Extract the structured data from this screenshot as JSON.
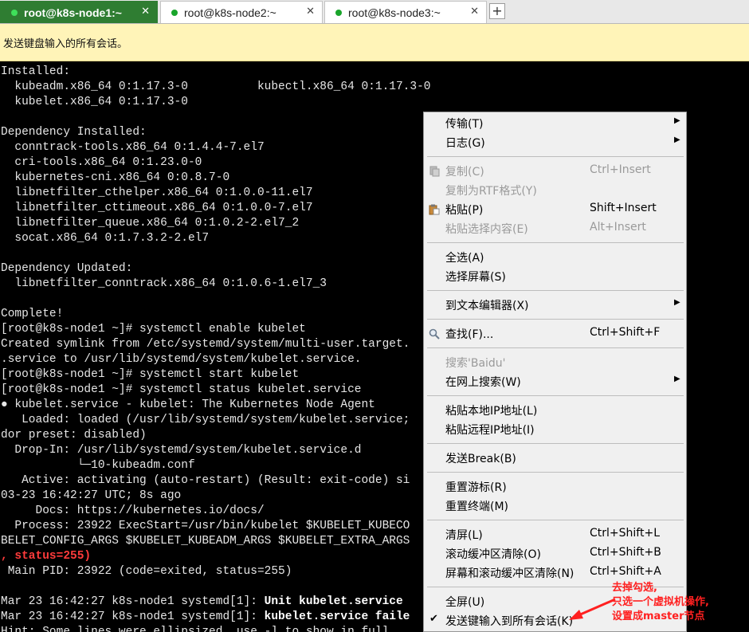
{
  "tabs": [
    {
      "label": "root@k8s-node1:~",
      "close": "✕"
    },
    {
      "label": "root@k8s-node2:~",
      "close": "✕"
    },
    {
      "label": "root@k8s-node3:~",
      "close": "✕"
    }
  ],
  "new_tab": "+",
  "banner": "发送键盘输入的所有会话。",
  "terminal": {
    "lines": [
      "Installed:",
      "  kubeadm.x86_64 0:1.17.3-0          kubectl.x86_64 0:1.17.3-0",
      "  kubelet.x86_64 0:1.17.3-0",
      "",
      "Dependency Installed:",
      "  conntrack-tools.x86_64 0:1.4.4-7.el7",
      "  cri-tools.x86_64 0:1.23.0-0",
      "  kubernetes-cni.x86_64 0:0.8.7-0",
      "  libnetfilter_cthelper.x86_64 0:1.0.0-11.el7",
      "  libnetfilter_cttimeout.x86_64 0:1.0.0-7.el7",
      "  libnetfilter_queue.x86_64 0:1.0.2-2.el7_2",
      "  socat.x86_64 0:1.7.3.2-2.el7",
      "",
      "Dependency Updated:",
      "  libnetfilter_conntrack.x86_64 0:1.0.6-1.el7_3",
      "",
      "Complete!",
      "[root@k8s-node1 ~]# systemctl enable kubelet",
      "Created symlink from /etc/systemd/system/multi-user.target.",
      ".service to /usr/lib/systemd/system/kubelet.service.",
      "[root@k8s-node1 ~]# systemctl start kubelet",
      "[root@k8s-node1 ~]# systemctl status kubelet.service",
      "● kubelet.service - kubelet: The Kubernetes Node Agent",
      "   Loaded: loaded (/usr/lib/systemd/system/kubelet.service;",
      "dor preset: disabled)",
      "  Drop-In: /usr/lib/systemd/system/kubelet.service.d",
      "           └─10-kubeadm.conf",
      "   Active: activating (auto-restart) (Result: exit-code) si",
      "03-23 16:42:27 UTC; 8s ago",
      "     Docs: https://kubernetes.io/docs/",
      "  Process: 23922 ExecStart=/usr/bin/kubelet $KUBELET_KUBECO",
      "BELET_CONFIG_ARGS $KUBELET_KUBEADM_ARGS $KUBELET_EXTRA_ARGS",
      ", status=255)",
      " Main PID: 23922 (code=exited, status=255)",
      "",
      "Mar 23 16:42:27 k8s-node1 systemd[1]: ",
      "Mar 23 16:42:27 k8s-node1 systemd[1]: ",
      "Hint: Some lines were ellipsized, use -l to show in full."
    ],
    "bold_35": "Unit kubelet.service",
    "bold_36": "kubelet.service faile"
  },
  "menu": {
    "items": [
      {
        "label": "传输(T)",
        "submenu": "▶"
      },
      {
        "label": "日志(G)",
        "submenu": "▶"
      },
      {
        "label": "复制(C)",
        "shortcut": "Ctrl+Insert"
      },
      {
        "label": "复制为RTF格式(Y)"
      },
      {
        "label": "粘贴(P)",
        "shortcut": "Shift+Insert"
      },
      {
        "label": "粘贴选择内容(E)",
        "shortcut": "Alt+Insert"
      },
      {
        "label": "全选(A)"
      },
      {
        "label": "选择屏幕(S)"
      },
      {
        "label": "到文本编辑器(X)",
        "submenu": "▶"
      },
      {
        "label": "查找(F)...",
        "shortcut": "Ctrl+Shift+F"
      },
      {
        "label": "搜索'Baidu'"
      },
      {
        "label": "在网上搜索(W)",
        "submenu": "▶"
      },
      {
        "label": "粘贴本地IP地址(L)"
      },
      {
        "label": "粘贴远程IP地址(I)"
      },
      {
        "label": "发送Break(B)"
      },
      {
        "label": "重置游标(R)"
      },
      {
        "label": "重置终端(M)"
      },
      {
        "label": "清屏(L)",
        "shortcut": "Ctrl+Shift+L"
      },
      {
        "label": "滚动缓冲区清除(O)",
        "shortcut": "Ctrl+Shift+B"
      },
      {
        "label": "屏幕和滚动缓冲区清除(N)",
        "shortcut": "Ctrl+Shift+A"
      },
      {
        "label": "全屏(U)"
      },
      {
        "label": "发送键输入到所有会话(K)",
        "check": "✔"
      }
    ]
  },
  "annotation": {
    "lines": [
      "去掉勾选,",
      "只选一个虚拟机操作,",
      "设置成master节点"
    ],
    "color": "#ff2020"
  }
}
